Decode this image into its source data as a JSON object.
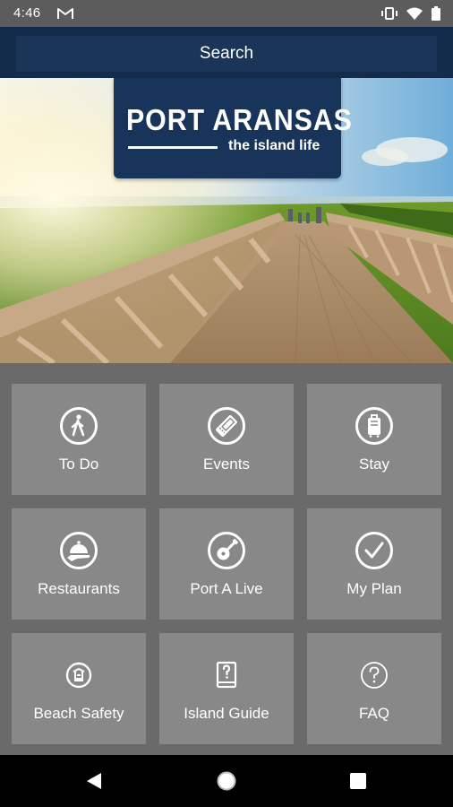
{
  "status_bar": {
    "time": "4:46",
    "icons": [
      "gmail-icon",
      "vibrate-icon",
      "wifi-icon",
      "battery-icon"
    ]
  },
  "search": {
    "label": "Search"
  },
  "hero": {
    "logo_title": "PORT ARANSAS",
    "logo_subtitle": "the island life",
    "brand_color": "#18345b"
  },
  "tiles": [
    {
      "label": "To Do",
      "icon": "walking-person-icon"
    },
    {
      "label": "Events",
      "icon": "ticket-icon"
    },
    {
      "label": "Stay",
      "icon": "luggage-icon"
    },
    {
      "label": "Restaurants",
      "icon": "food-cloche-icon"
    },
    {
      "label": "Port A Live",
      "icon": "guitar-icon"
    },
    {
      "label": "My Plan",
      "icon": "checkmark-icon"
    },
    {
      "label": "Beach Safety",
      "icon": "beach-safety-icon"
    },
    {
      "label": "Island Guide",
      "icon": "guide-book-icon"
    },
    {
      "label": "FAQ",
      "icon": "question-icon"
    }
  ],
  "nav_bar": {
    "buttons": [
      "back-icon",
      "home-icon",
      "recents-icon"
    ]
  }
}
